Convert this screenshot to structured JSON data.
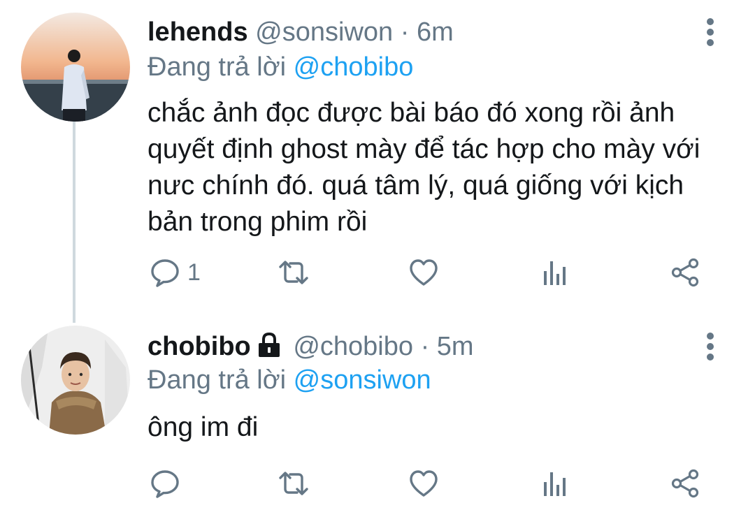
{
  "tweets": [
    {
      "name": "lehends",
      "handle": "@sonsiwon",
      "separator": "·",
      "time": "6m",
      "reply_label": "Đang trả lời",
      "reply_to": "@chobibo",
      "text": "chắc ảnh đọc được bài báo đó xong rồi ảnh quyết định ghost mày để tác hợp cho mày với nưc chính đó. quá tâm lý, quá giống với kịch bản trong phim rồi",
      "reply_count": "1",
      "protected": false
    },
    {
      "name": "chobibo",
      "handle": "@chobibo",
      "separator": "·",
      "time": "5m",
      "reply_label": "Đang trả lời",
      "reply_to": "@sonsiwon",
      "text": "ông im đi",
      "reply_count": "",
      "protected": true
    }
  ],
  "colors": {
    "accent": "#1da1f2",
    "secondary_text": "#657786",
    "thread_line": "#cfd9de"
  },
  "icons": [
    "reply-icon",
    "retweet-icon",
    "like-icon",
    "analytics-icon",
    "share-icon",
    "more-options-icon",
    "lock-icon"
  ]
}
